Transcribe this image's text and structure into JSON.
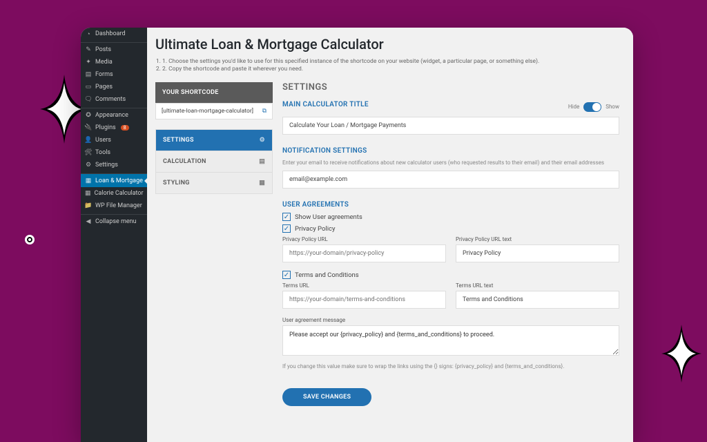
{
  "sidebar": [
    {
      "label": "Dashboard",
      "icon": "◔"
    },
    {
      "label": "Posts",
      "icon": "✎",
      "sep": true
    },
    {
      "label": "Media",
      "icon": "✦"
    },
    {
      "label": "Forms",
      "icon": "▤"
    },
    {
      "label": "Pages",
      "icon": "▭"
    },
    {
      "label": "Comments",
      "icon": "🗨"
    },
    {
      "label": "Appearance",
      "icon": "✪",
      "sep": true
    },
    {
      "label": "Plugins",
      "icon": "🔌",
      "badge": "8"
    },
    {
      "label": "Users",
      "icon": "👤"
    },
    {
      "label": "Tools",
      "icon": "🛠"
    },
    {
      "label": "Settings",
      "icon": "⚙"
    },
    {
      "label": "Loan & Mortgage",
      "icon": "▦",
      "sep": true,
      "active": true
    },
    {
      "label": "Calorie Calculator",
      "icon": "▦"
    },
    {
      "label": "WP File Manager",
      "icon": "📁"
    },
    {
      "label": "Collapse menu",
      "icon": "◀",
      "sep": true
    }
  ],
  "page": {
    "title": "Ultimate Loan & Mortgage Calculator",
    "instructions": [
      "1. Choose the settings you'd like to use for this specified instance of the shortcode on your website (widget, a particular page, or something else).",
      "2. Copy the shortcode and paste it wherever you need."
    ]
  },
  "shortcode": {
    "heading": "YOUR SHORTCODE",
    "value": "[ultimate-loan-mortgage-calculator]"
  },
  "tabs": [
    {
      "label": "SETTINGS",
      "icon": "⚙",
      "active": true
    },
    {
      "label": "CALCULATION",
      "icon": "▤"
    },
    {
      "label": "STYLING",
      "icon": "▦"
    }
  ],
  "settings": {
    "heading": "SETTINGS",
    "mainTitle": {
      "label": "MAIN CALCULATOR TITLE",
      "hide": "Hide",
      "show": "Show",
      "value": "Calculate Your Loan / Mortgage Payments"
    },
    "notif": {
      "label": "NOTIFICATION SETTINGS",
      "hint": "Enter your email to receive notifications about new calculator users (who requested results to their email) and their email addresses",
      "value": "email@example.com"
    },
    "agreements": {
      "label": "USER AGREEMENTS",
      "showUser": "Show User agreements",
      "privacy": "Privacy Policy",
      "privacyUrlLabel": "Privacy Policy URL",
      "privacyUrlPlaceholder": "https://your-domain/privacy-policy",
      "privacyTextLabel": "Privacy Policy URL text",
      "privacyTextValue": "Privacy Policy",
      "terms": "Terms and Conditions",
      "termsUrlLabel": "Terms URL",
      "termsUrlPlaceholder": "https://your-domain/terms-and-conditions",
      "termsTextLabel": "Terms URL text",
      "termsTextValue": "Terms and Conditions",
      "msgLabel": "User agreement message",
      "msgValue": "Please accept our {privacy_policy} and {terms_and_conditions} to proceed.",
      "msgHint": "If you change this value make sure to wrap the links using the {} signs: {privacy_policy} and {terms_and_conditions}."
    },
    "save": "SAVE CHANGES"
  }
}
